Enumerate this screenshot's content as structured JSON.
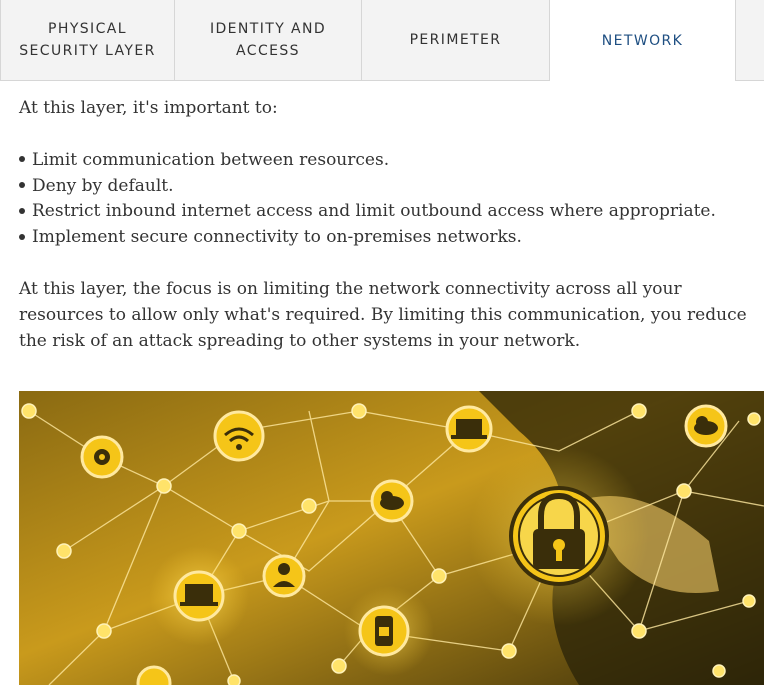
{
  "tabs": [
    {
      "label": "PHYSICAL\nSECURITY LAYER",
      "active": false
    },
    {
      "label": "IDENTITY AND\nACCESS",
      "active": false
    },
    {
      "label": "PERIMETER",
      "active": false
    },
    {
      "label": "NETWORK",
      "active": true
    },
    {
      "label": "",
      "active": false
    }
  ],
  "content": {
    "intro": "At this layer, it's important to:",
    "bullets": [
      "Limit communication between resources.",
      "Deny by default.",
      "Restrict inbound internet access and limit outbound access where appropriate.",
      "Implement secure connectivity to on-premises networks."
    ],
    "paragraph": "At this layer, the focus is on limiting the network connectivity across all your resources to allow only what's required. By limiting this communication, you reduce the risk of an attack spreading to other systems in your network."
  },
  "image": {
    "icons": [
      "padlock-icon",
      "wifi-icon",
      "laptop-lock-icon",
      "cloud-upload-icon",
      "cloud-download-icon",
      "user-icon",
      "phone-lock-icon",
      "gear-network-icon"
    ]
  },
  "colors": {
    "active_tab_text": "#1f4f82",
    "tab_background": "#f3f3f3",
    "node_gold": "#f5c518",
    "image_dark": "#2a2308"
  }
}
